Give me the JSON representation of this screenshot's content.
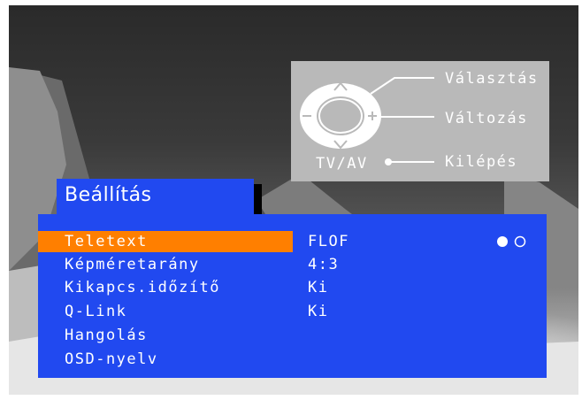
{
  "legend": {
    "select_label": "Választás",
    "change_label": "Változás",
    "exit_label": "Kilépés",
    "tvav_label": "TV/AV"
  },
  "menu": {
    "title": "Beállítás",
    "items": [
      {
        "label": "Teletext",
        "value": "FLOF",
        "selected": true
      },
      {
        "label": "Képméretarány",
        "value": "4:3"
      },
      {
        "label": "Kikapcs.időzítő",
        "value": "Ki"
      },
      {
        "label": "Q-Link",
        "value": "Ki"
      },
      {
        "label": "Hangolás",
        "value": ""
      },
      {
        "label": "OSD-nyelv",
        "value": ""
      }
    ],
    "page_indicator": {
      "current": 1,
      "total": 2
    }
  },
  "colors": {
    "menu_bg": "#2149f0",
    "highlight": "#ff7f00",
    "legend_bg": "#b9b9b9",
    "text": "#ffffff"
  }
}
